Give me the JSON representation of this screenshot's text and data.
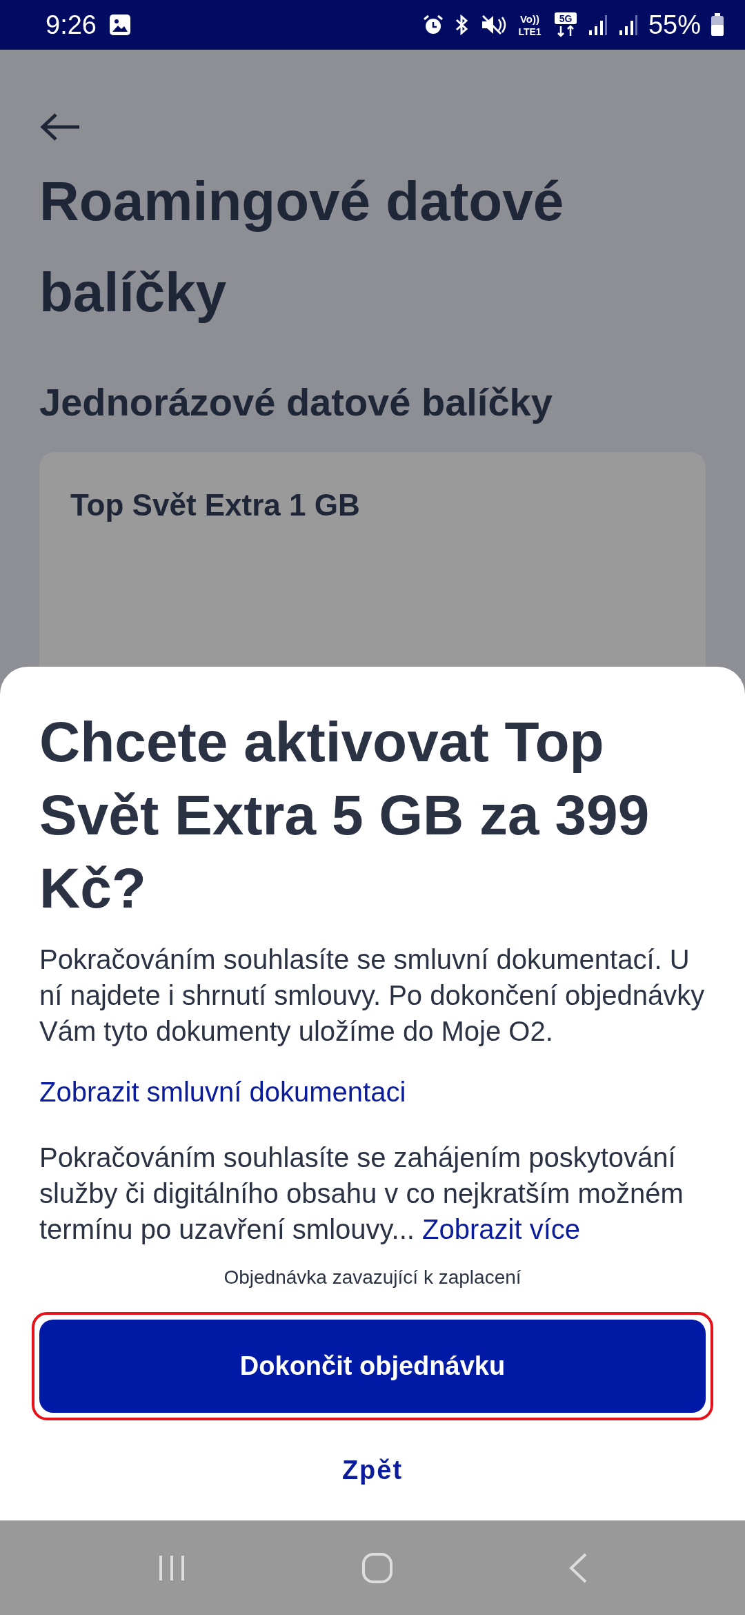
{
  "status_bar": {
    "time": "9:26",
    "volte": "Vo))",
    "lte": "LTE1",
    "network": "5G",
    "battery": "55%"
  },
  "page": {
    "title": "Roamingové datové balíčky",
    "section": "Jednorázové datové balíčky",
    "card_title": "Top Svět Extra 1 GB"
  },
  "sheet": {
    "title": "Chcete aktivovat Top Svět Extra 5 GB za 399 Kč?",
    "paragraph_1": "Pokračováním souhlasíte se smluvní dokumentací. U ní najdete i shrnutí smlouvy. Po dokončení objednávky Vám tyto dokumenty uložíme do Moje O2.",
    "documents_link": "Zobrazit smluvní dokumentaci",
    "paragraph_2": "Pokračováním souhlasíte se zahájením poskytování služby či digitálního obsahu v co nejkratším možném termínu po uzavření smlouvy...",
    "more_link": "Zobrazit více",
    "note": "Objednávka zavazující k zaplacení",
    "confirm_button": {
      "label": "Dokončit objednávku",
      "highlighted": true
    },
    "back_button": "Zpět"
  }
}
